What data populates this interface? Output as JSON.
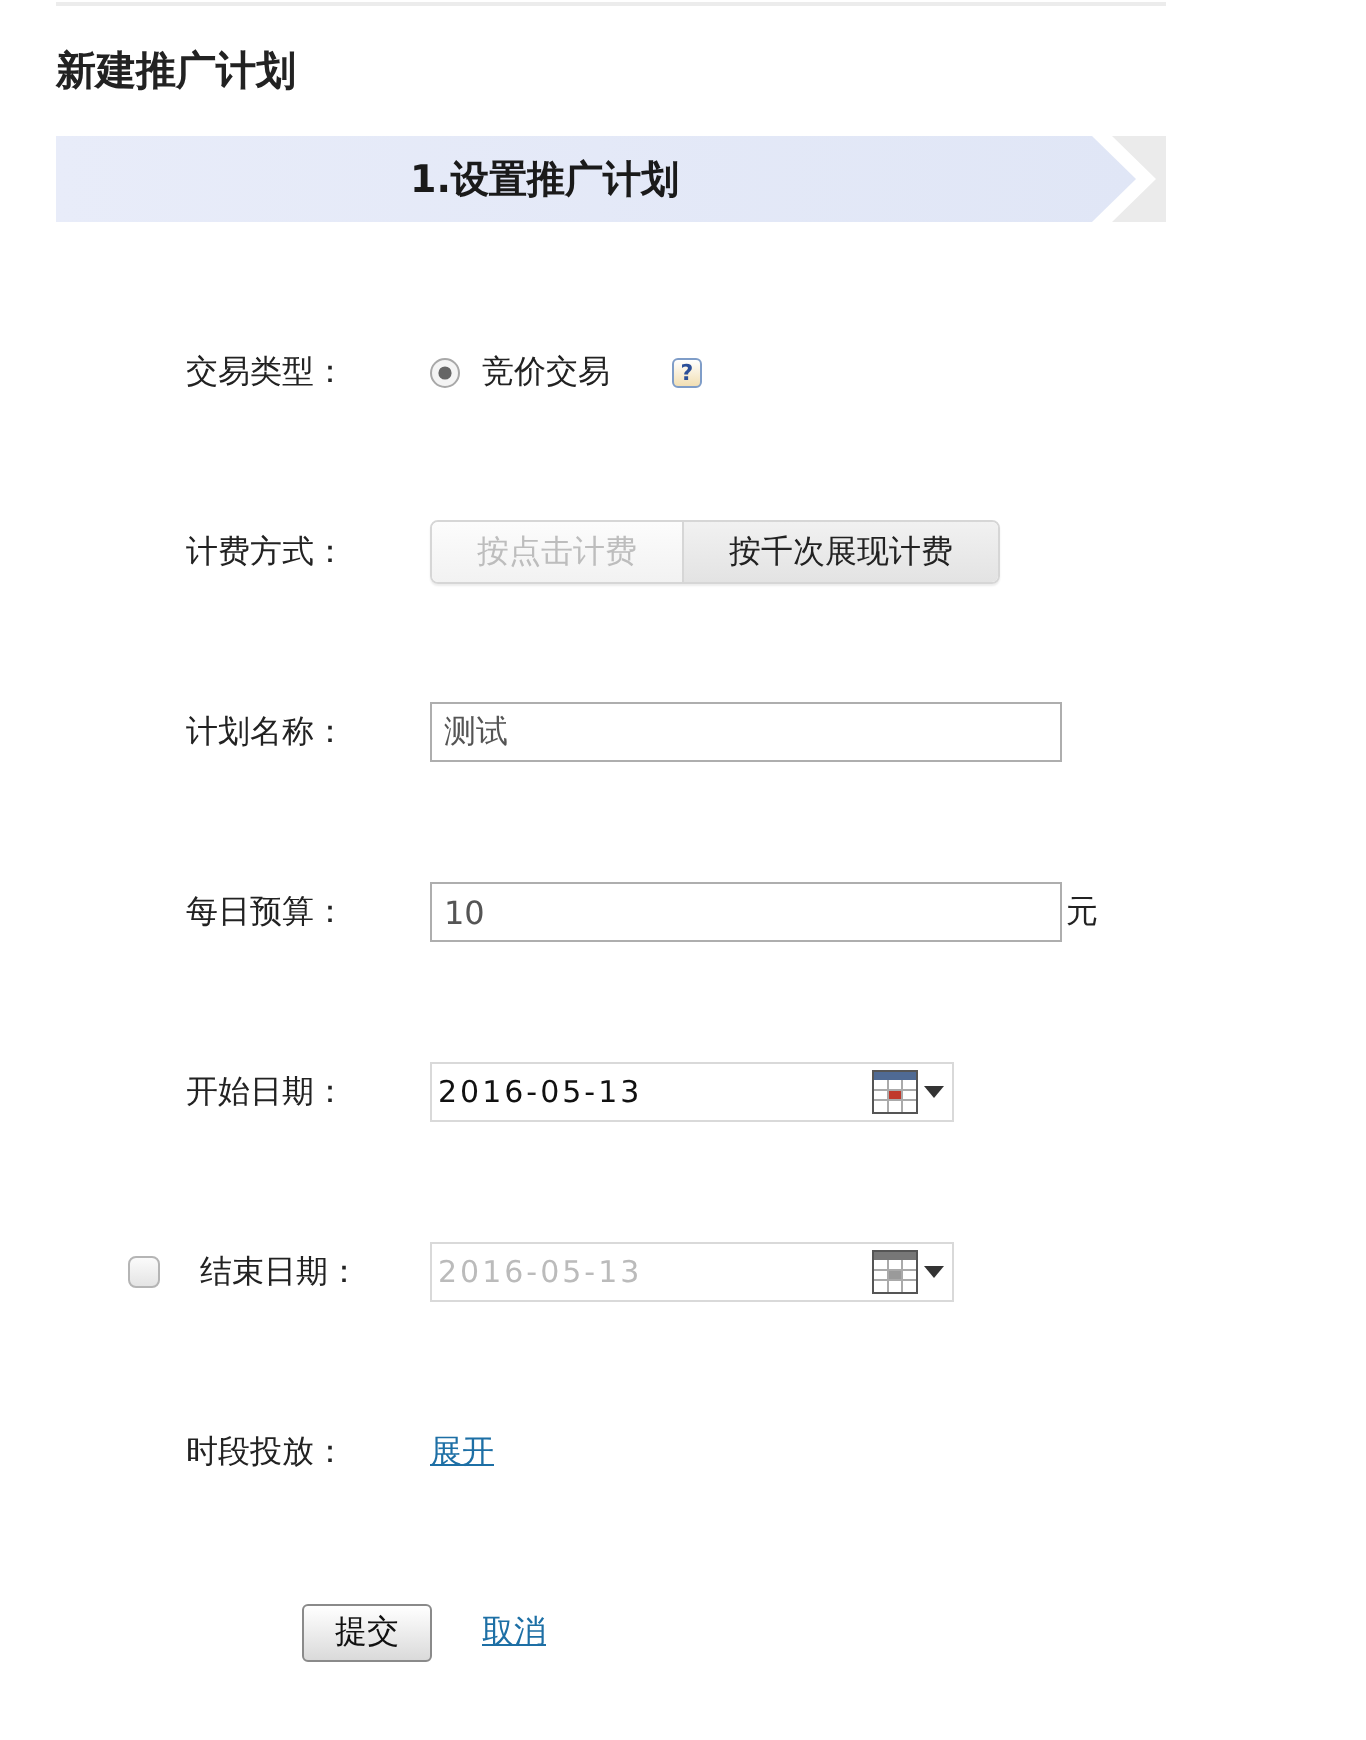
{
  "page_title": "新建推广计划",
  "steps": [
    {
      "label": "1.设置推广计划",
      "selected": true
    }
  ],
  "fields": [
    {
      "kind": "radio",
      "label": "交易类型：",
      "options": [
        {
          "label": "竞价交易",
          "selected": true
        }
      ],
      "help": "?"
    },
    {
      "kind": "segmented",
      "label": "计费方式：",
      "options": [
        {
          "label": "按点击计费",
          "selected": true
        },
        {
          "label": "按千次展现计费",
          "selected": false
        }
      ]
    },
    {
      "kind": "text",
      "label": "计划名称：",
      "value": "测试"
    },
    {
      "kind": "text",
      "label": "每日预算：",
      "value": "10",
      "unit": "元"
    },
    {
      "kind": "date",
      "label": "开始日期：",
      "value": "2016-05-13",
      "disabled": false
    },
    {
      "kind": "date",
      "label": "结束日期：",
      "value": "2016-05-13",
      "disabled": true,
      "checked": false
    },
    {
      "kind": "link",
      "label": "时段投放：",
      "link": "展开"
    }
  ],
  "actions": {
    "submit": "提交",
    "cancel": "取消"
  }
}
